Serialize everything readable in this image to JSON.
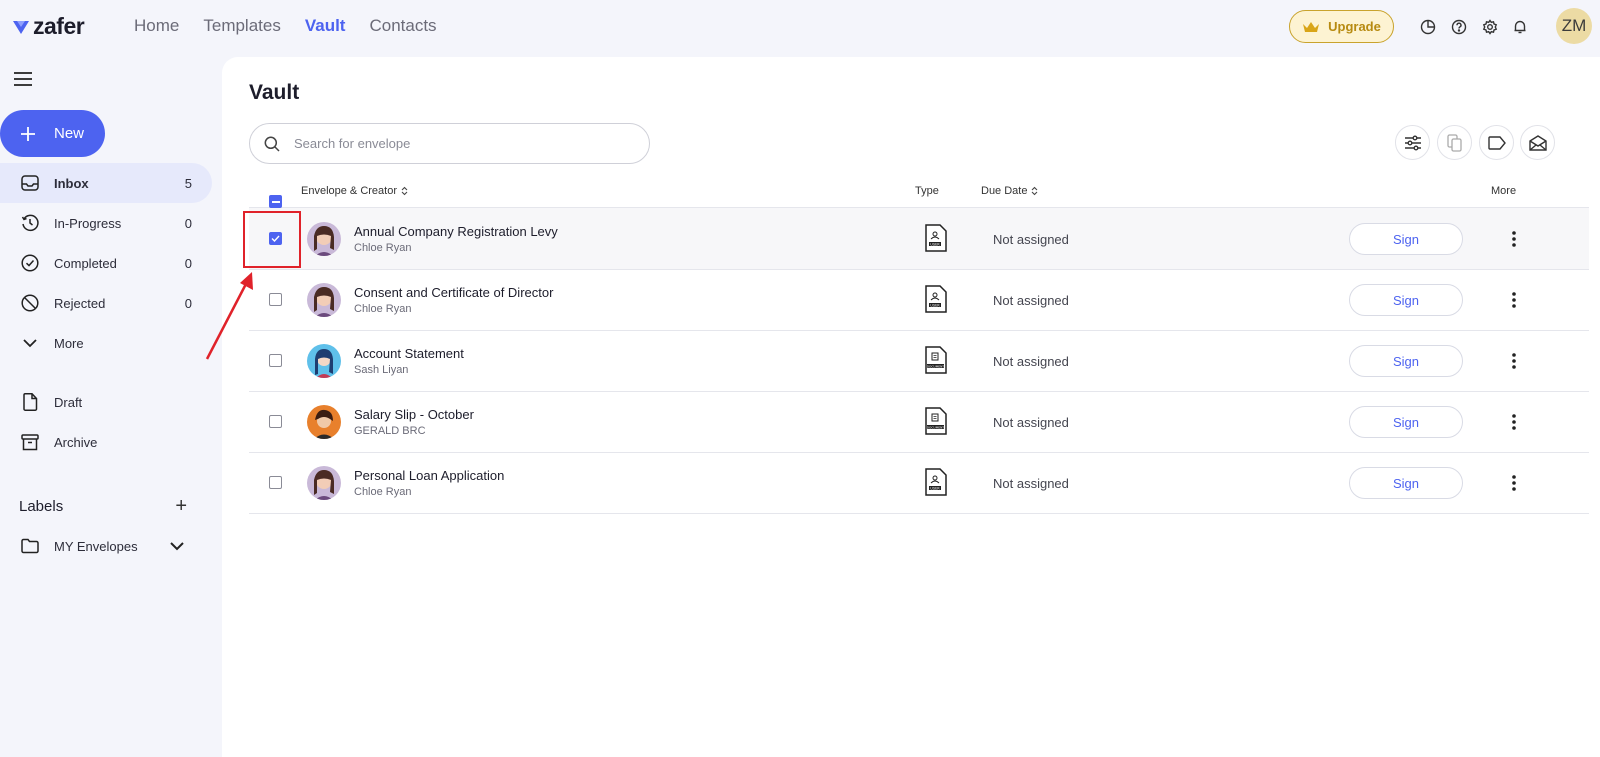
{
  "brand": {
    "name": "zafer",
    "color": "#4d63f0"
  },
  "nav": [
    {
      "label": "Home",
      "active": false
    },
    {
      "label": "Templates",
      "active": false
    },
    {
      "label": "Vault",
      "active": true
    },
    {
      "label": "Contacts",
      "active": false
    }
  ],
  "header": {
    "upgrade_label": "Upgrade",
    "icons": [
      "chart-icon",
      "help-icon",
      "settings-icon",
      "bell-icon"
    ],
    "user_initials": "ZM"
  },
  "sidebar": {
    "new_label": "New",
    "items": [
      {
        "label": "Inbox",
        "count": "5",
        "icon": "inbox-icon",
        "active": true
      },
      {
        "label": "In-Progress",
        "count": "0",
        "icon": "clock-icon",
        "active": false
      },
      {
        "label": "Completed",
        "count": "0",
        "icon": "check-circle-icon",
        "active": false
      },
      {
        "label": "Rejected",
        "count": "0",
        "icon": "ban-icon",
        "active": false
      },
      {
        "label": "More",
        "count": "",
        "icon": "chevron-down-icon",
        "active": false
      },
      {
        "label": "Draft",
        "count": "",
        "icon": "file-icon",
        "active": false
      },
      {
        "label": "Archive",
        "count": "",
        "icon": "archive-icon",
        "active": false
      }
    ],
    "labels_title": "Labels",
    "label_folder": "MY Envelopes"
  },
  "main": {
    "title": "Vault",
    "search_placeholder": "Search for envelope",
    "columns": {
      "envelope": "Envelope & Creator",
      "type": "Type",
      "due": "Due Date",
      "more": "More"
    },
    "rows": [
      {
        "title": "Annual Company Registration Levy",
        "creator": "Chloe Ryan",
        "type": "USER",
        "due": "Not assigned",
        "action": "Sign",
        "checked": true
      },
      {
        "title": "Consent and Certificate of Director",
        "creator": "Chloe Ryan",
        "type": "USER",
        "due": "Not assigned",
        "action": "Sign",
        "checked": false
      },
      {
        "title": "Account Statement",
        "creator": "Sash Liyan",
        "type": "DOCUMENT",
        "due": "Not assigned",
        "action": "Sign",
        "checked": false
      },
      {
        "title": "Salary Slip - October",
        "creator": "GERALD BRC",
        "type": "DOCUMENT",
        "due": "Not assigned",
        "action": "Sign",
        "checked": false
      },
      {
        "title": "Personal Loan Application",
        "creator": "Chloe Ryan",
        "type": "USER",
        "due": "Not assigned",
        "action": "Sign",
        "checked": false
      }
    ]
  }
}
